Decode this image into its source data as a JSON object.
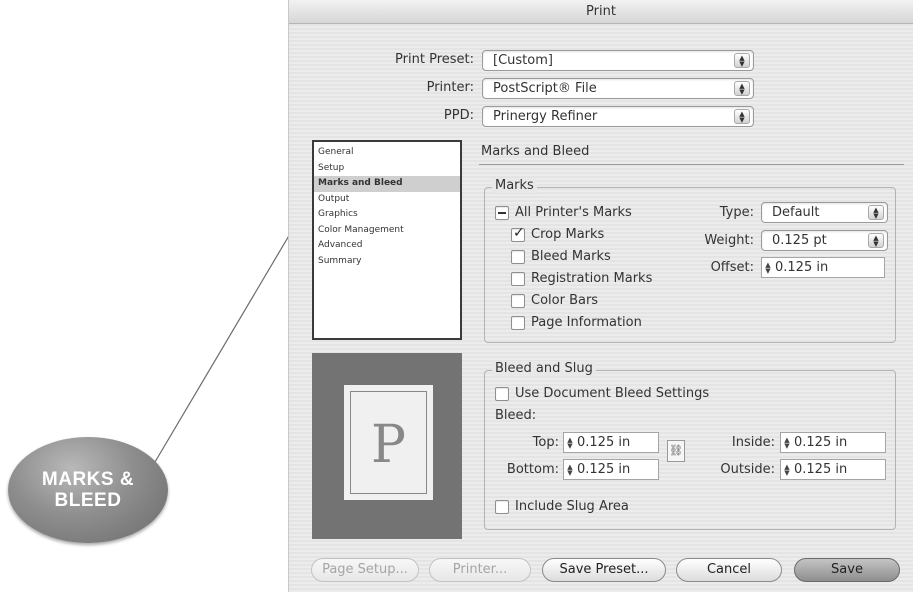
{
  "callout": {
    "line1": "MARKS &",
    "line2": "BLEED"
  },
  "dialog": {
    "title": "Print",
    "print_preset": {
      "label": "Print Preset:",
      "value": "[Custom]"
    },
    "printer": {
      "label": "Printer:",
      "value": "PostScript® File"
    },
    "ppd": {
      "label": "PPD:",
      "value": "Prinergy Refiner"
    },
    "categories": [
      "General",
      "Setup",
      "Marks and Bleed",
      "Output",
      "Graphics",
      "Color Management",
      "Advanced",
      "Summary"
    ],
    "selected_category": "Marks and Bleed",
    "section_title": "Marks and Bleed",
    "preview_letter": "P",
    "marks": {
      "group_title": "Marks",
      "all_printers_marks": {
        "label": "All Printer's Marks",
        "state": "mixed"
      },
      "crop_marks": {
        "label": "Crop Marks",
        "checked": true
      },
      "bleed_marks": {
        "label": "Bleed Marks",
        "checked": false
      },
      "registration_marks": {
        "label": "Registration Marks",
        "checked": false
      },
      "color_bars": {
        "label": "Color Bars",
        "checked": false
      },
      "page_information": {
        "label": "Page Information",
        "checked": false
      },
      "type": {
        "label": "Type:",
        "value": "Default"
      },
      "weight": {
        "label": "Weight:",
        "value": "0.125 pt"
      },
      "offset": {
        "label": "Offset:",
        "value": "0.125 in"
      }
    },
    "bleed_slug": {
      "group_title": "Bleed and Slug",
      "use_document_bleed": {
        "label": "Use Document Bleed Settings",
        "checked": false
      },
      "bleed_label": "Bleed:",
      "top": {
        "label": "Top:",
        "value": "0.125 in"
      },
      "bottom": {
        "label": "Bottom:",
        "value": "0.125 in"
      },
      "inside": {
        "label": "Inside:",
        "value": "0.125 in"
      },
      "outside": {
        "label": "Outside:",
        "value": "0.125 in"
      },
      "include_slug": {
        "label": "Include Slug Area",
        "checked": false
      }
    },
    "buttons": {
      "page_setup": "Page Setup...",
      "printer": "Printer...",
      "save_preset": "Save Preset...",
      "cancel": "Cancel",
      "save": "Save"
    }
  }
}
